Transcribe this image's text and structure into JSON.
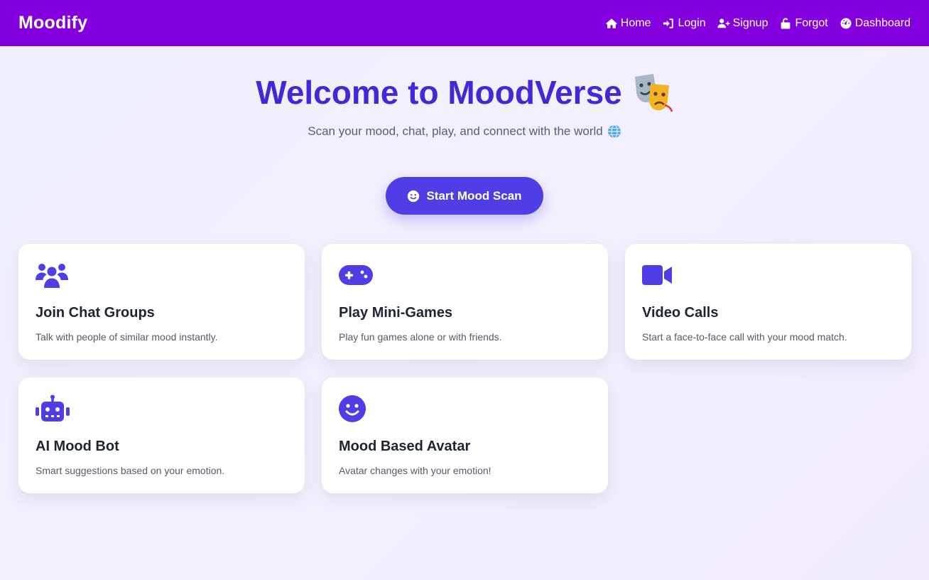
{
  "brand": "Moodify",
  "nav": {
    "home": "Home",
    "login": "Login",
    "signup": "Signup",
    "forgot": "Forgot",
    "dashboard": "Dashboard"
  },
  "hero": {
    "title": "Welcome to MoodVerse",
    "subtitle": "Scan your mood, chat, play, and connect with the world",
    "cta_label": "Start Mood Scan"
  },
  "cards": [
    {
      "title": "Join Chat Groups",
      "description": "Talk with people of similar mood instantly.",
      "icon": "users-icon"
    },
    {
      "title": "Play Mini-Games",
      "description": "Play fun games alone or with friends.",
      "icon": "gamepad-icon"
    },
    {
      "title": "Video Calls",
      "description": "Start a face-to-face call with your mood match.",
      "icon": "video-camera-icon"
    },
    {
      "title": "AI Mood Bot",
      "description": "Smart suggestions based on your emotion.",
      "icon": "robot-icon"
    },
    {
      "title": "Mood Based Avatar",
      "description": "Avatar changes with your emotion!",
      "icon": "smiley-icon"
    }
  ],
  "colors": {
    "navbar": "#8400de",
    "accent": "#4f3ee6",
    "title": "#4427d6"
  }
}
